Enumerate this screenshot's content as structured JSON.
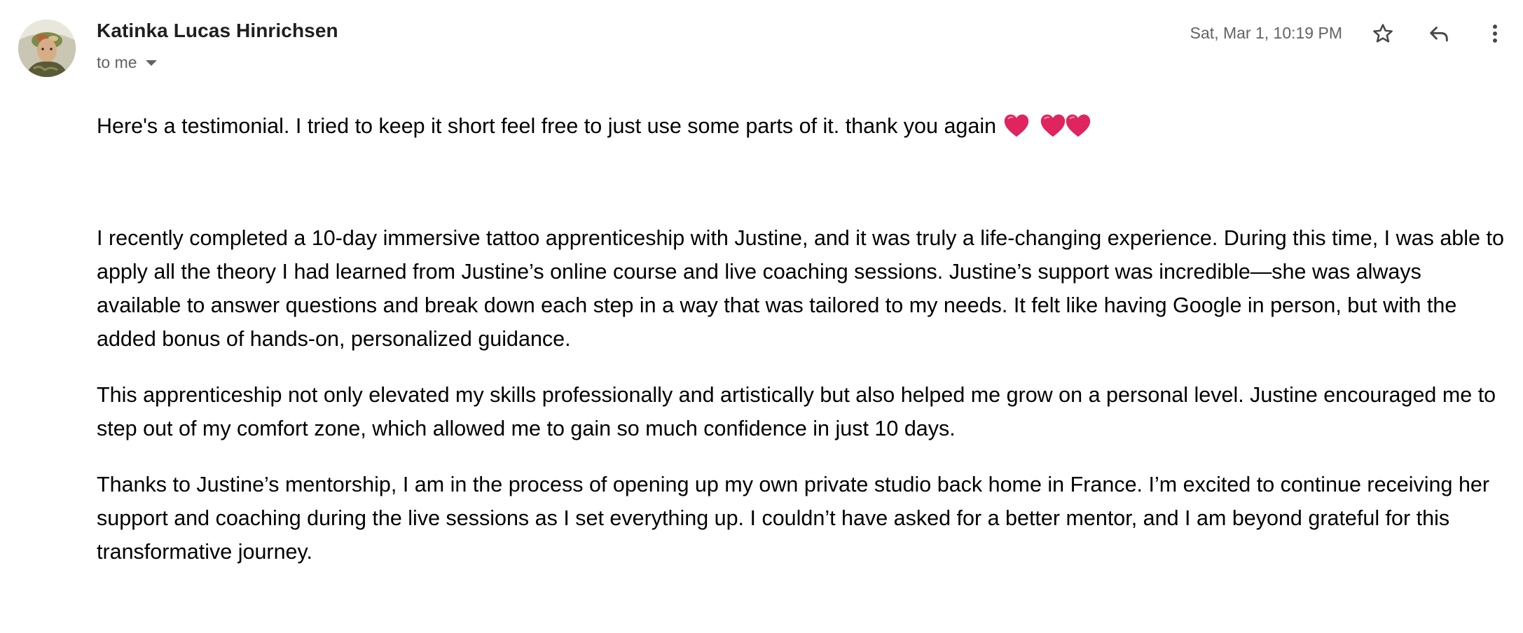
{
  "header": {
    "sender_name": "Katinka Lucas Hinrichsen",
    "recipient_label": "to me",
    "timestamp": "Sat, Mar 1, 10:19 PM",
    "avatar_icon": "sender-photo",
    "actions": {
      "star_icon": "star-icon",
      "reply_icon": "reply-icon",
      "more_icon": "more-vert-icon"
    }
  },
  "body": {
    "intro": "Here's a testimonial. I tried to keep it short feel free to just use some parts of it. thank you again",
    "intro_emoji": "❤️ ❤️❤️",
    "paragraphs": [
      "I recently completed a 10-day immersive tattoo apprenticeship with Justine, and it was truly a life-changing experience. During this time, I was able to apply all the theory I had learned from Justine’s online course and live coaching sessions. Justine’s support was incredible—she was always available to answer questions and break down each step in a way that was tailored to my needs. It felt like having Google in person, but with the added bonus of hands-on, personalized guidance.",
      "This apprenticeship not only elevated my skills professionally and artistically but also helped me grow on a personal level. Justine encouraged me to step out of my comfort zone, which allowed me to gain so much confidence in just 10 days.",
      "Thanks to Justine’s mentorship, I am in the process of opening up my own private studio back home in France. I’m excited to continue receiving her support and coaching during the live sessions as I set everything up. I couldn’t have asked for a better mentor, and I am beyond grateful for this transformative journey."
    ]
  },
  "colors": {
    "heart": "#e0245e",
    "secondary_text": "#5f6368",
    "icon": "#444746"
  }
}
